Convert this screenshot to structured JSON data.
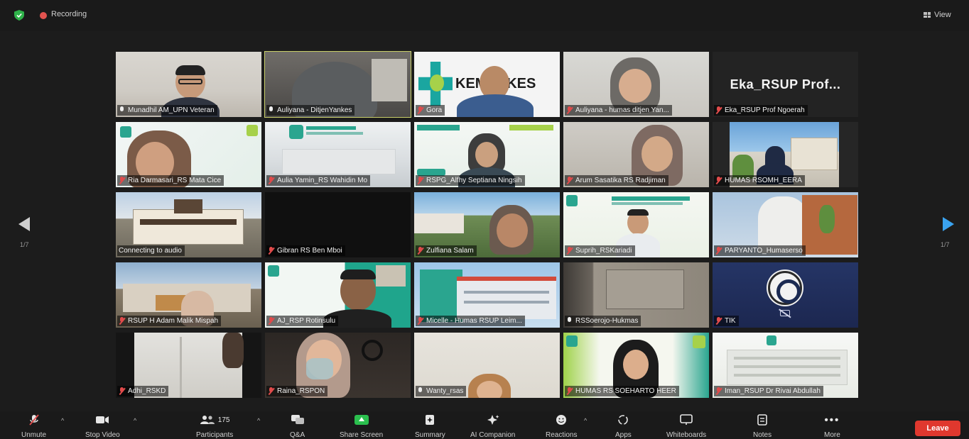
{
  "topbar": {
    "recording_label": "Recording",
    "view_label": "View"
  },
  "pagination": {
    "left": "1/7",
    "right": "1/7"
  },
  "participants": [
    {
      "name": "Munadhil AM_UPN Veteran",
      "muted": false
    },
    {
      "name": "Auliyana - DitjenYankes",
      "muted": false,
      "active": true
    },
    {
      "name": "Gora",
      "muted": true,
      "overlay_text": "KEMENKES"
    },
    {
      "name": "Auliyana - humas ditjen Yan...",
      "muted": true
    },
    {
      "name": "Eka_RSUP Prof Ngoerah",
      "muted": true,
      "big_text": "Eka_RSUP  Prof..."
    },
    {
      "name": "Ria Darmasari_RS Mata Cice",
      "muted": true
    },
    {
      "name": "Aulia Yamin_RS Wahidin Mo",
      "muted": true
    },
    {
      "name": "RSPG_Alfhy Septiana Ningsih",
      "muted": true
    },
    {
      "name": "Arum Sasatika RS Radjiman",
      "muted": true
    },
    {
      "name": "HUMAS RSOMH_EERA",
      "muted": true
    },
    {
      "name": "Connecting to audio",
      "muted": false,
      "connecting": true
    },
    {
      "name": "Gibran RS Ben Mboi",
      "muted": true
    },
    {
      "name": "Zulfiana Salam",
      "muted": true
    },
    {
      "name": "Suprih_RSKariadi",
      "muted": true
    },
    {
      "name": "PARYANTO_Humaserso",
      "muted": true
    },
    {
      "name": "RSUP H Adam Malik Mispah",
      "muted": true
    },
    {
      "name": "AJ_RSP Rotinsulu",
      "muted": true
    },
    {
      "name": "Micelle - Humas RSUP Leim...",
      "muted": true
    },
    {
      "name": "RSSoerojo-Hukmas",
      "muted": false
    },
    {
      "name": "TIK",
      "muted": true
    },
    {
      "name": "Adhi_RSKD",
      "muted": true
    },
    {
      "name": "Raina_RSPON",
      "muted": true
    },
    {
      "name": "Wanty_rsas",
      "muted": false
    },
    {
      "name": "HUMAS RS SOEHARTO HEER",
      "muted": true
    },
    {
      "name": "Iman_RSUP Dr Rivai Abdullah",
      "muted": true
    }
  ],
  "toolbar": {
    "unmute": "Unmute",
    "stop_video": "Stop Video",
    "participants": "Participants",
    "participant_count": "175",
    "qa": "Q&A",
    "share_screen": "Share Screen",
    "summary": "Summary",
    "ai_companion": "AI Companion",
    "reactions": "Reactions",
    "apps": "Apps",
    "whiteboards": "Whiteboards",
    "notes": "Notes",
    "more": "More",
    "leave": "Leave"
  }
}
